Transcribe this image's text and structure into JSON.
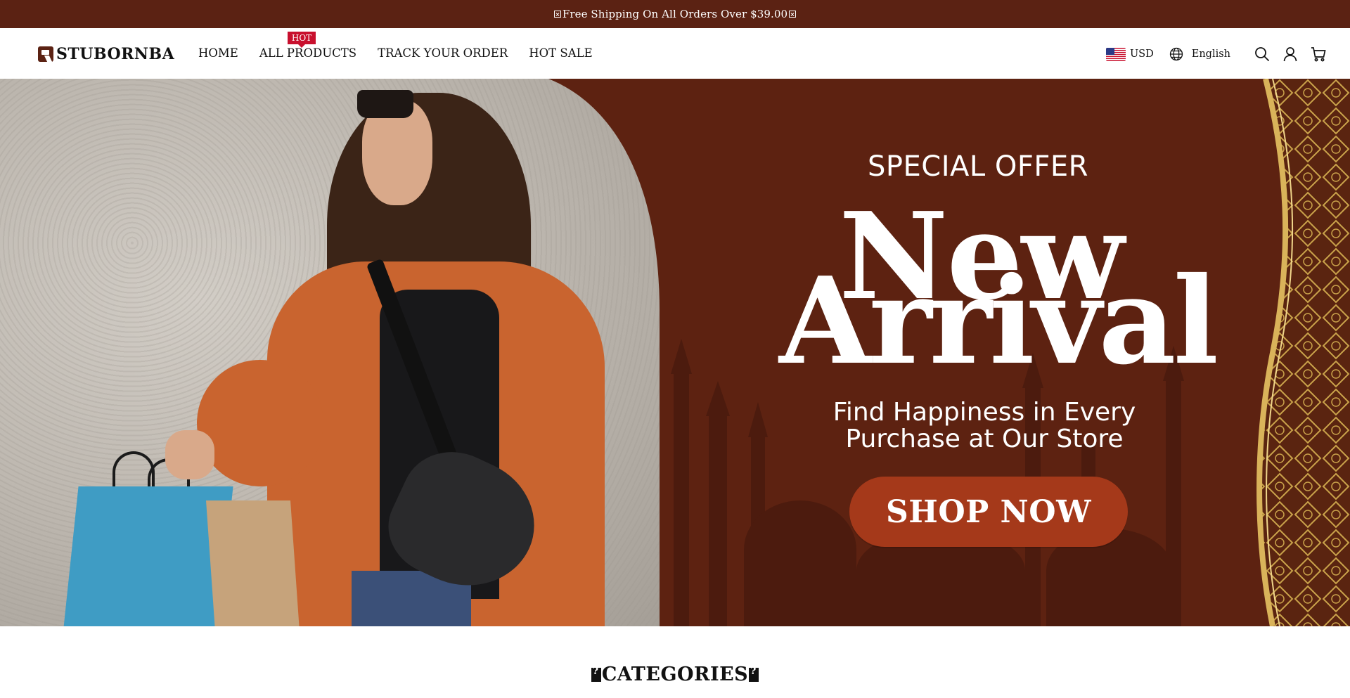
{
  "announcement": {
    "text": "Free Shipping On All Orders Over $39.00"
  },
  "header": {
    "brand": "STUBORNBA",
    "nav": [
      {
        "label": "HOME"
      },
      {
        "label": "ALL PRODUCTS",
        "badge": "HOT"
      },
      {
        "label": "TRACK YOUR ORDER"
      },
      {
        "label": "HOT SALE"
      }
    ],
    "currency": "USD",
    "language": "English",
    "icons": [
      "us-flag-icon",
      "globe-icon",
      "search-icon",
      "user-icon",
      "cart-icon"
    ]
  },
  "hero": {
    "eyebrow": "SPECIAL OFFER",
    "headline_line1": "New",
    "headline_line2": "Arrival",
    "tagline_line1": "Find Happiness in Every",
    "tagline_line2": "Purchase at Our Store",
    "cta": "SHOP NOW"
  },
  "sections": {
    "categories_title": "CATEGORIES"
  },
  "colors": {
    "announcement_bg": "#5b2213",
    "hero_bg": "#5d2211",
    "cta_bg": "#a5391a",
    "badge_bg": "#c8102e",
    "gold": "#c9a24a"
  }
}
